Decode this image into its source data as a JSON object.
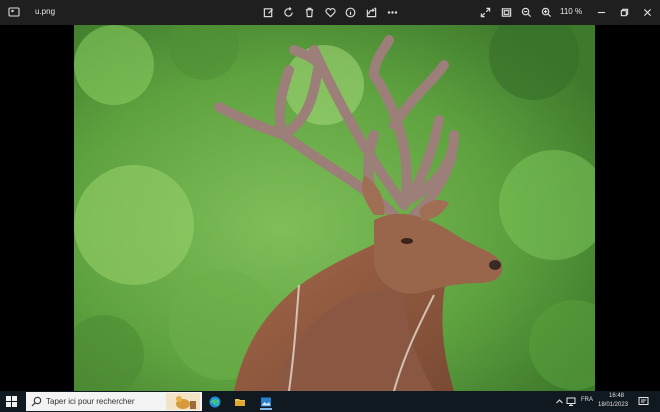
{
  "window": {
    "filename": "u.png",
    "zoom_level": "110 %"
  },
  "toolbar": {
    "items": [
      "edit-icon",
      "rotate-icon",
      "delete-icon",
      "favorite-icon",
      "info-icon",
      "share-icon",
      "more-icon"
    ],
    "view_items": [
      "fullscreen-icon",
      "fit-icon",
      "zoom-out-icon",
      "zoom-in-icon"
    ]
  },
  "image": {
    "subject": "deer"
  },
  "taskbar": {
    "search_placeholder": "Taper ici pour rechercher",
    "language": "FRA",
    "time": "16:48",
    "date": "18/01/2023",
    "pinned": [
      "edge-icon",
      "file-explorer-icon",
      "photos-icon"
    ]
  },
  "colors": {
    "titlebar": "#1f1f1f",
    "taskbar": "#101820",
    "accent": "#7fb7e8"
  }
}
